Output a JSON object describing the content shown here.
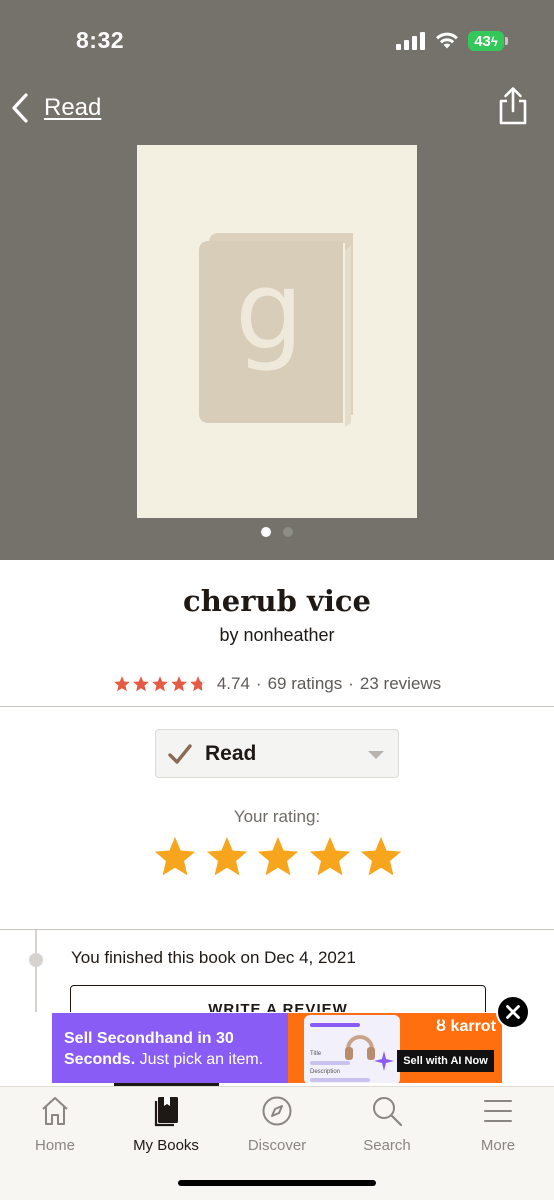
{
  "status_bar": {
    "time": "8:32",
    "battery": "43"
  },
  "nav": {
    "back_label": "Read",
    "back_icon": "chevron-left-icon",
    "share_icon": "share-icon"
  },
  "cover": {
    "placeholder_icon": "goodreads-book-icon",
    "logo_letter": "g",
    "page_count": 2,
    "current_page": 1
  },
  "book": {
    "title": "cherub vice",
    "author": "by nonheather",
    "average_rating": "4.74",
    "average_rating_value": 4.74,
    "ratings_count": "69 ratings",
    "reviews_count": "23 reviews",
    "separator": "·"
  },
  "shelf": {
    "status_label": "Read",
    "check_icon": "checkmark-icon",
    "caret_icon": "caret-down-icon"
  },
  "user_rating": {
    "label": "Your rating:",
    "stars": 5,
    "max_stars": 5
  },
  "activity": {
    "finished_text": "You finished this book on Dec 4, 2021",
    "write_review_label": "WRITE A REVIEW"
  },
  "ad": {
    "headline_bold": "Sell Secondhand in 30 Seconds.",
    "headline_rest": " Just pick an item.",
    "brand": "karrot",
    "cta": "Sell with AI Now",
    "close_icon": "close-icon",
    "mock_title": "Title",
    "mock_desc": "Description"
  },
  "tabs": [
    {
      "label": "Home",
      "icon": "home-icon"
    },
    {
      "label": "My Books",
      "icon": "my-books-icon",
      "active": true
    },
    {
      "label": "Discover",
      "icon": "compass-icon"
    },
    {
      "label": "Search",
      "icon": "search-icon"
    },
    {
      "label": "More",
      "icon": "menu-icon"
    }
  ],
  "colors": {
    "header_bg": "#74726b",
    "cover_bg": "#f3f0e2",
    "avg_star": "#e55a42",
    "user_star": "#f7a51c",
    "ad_purple": "#8a5cf6",
    "ad_orange": "#ff6f0f",
    "battery": "#34c759"
  }
}
